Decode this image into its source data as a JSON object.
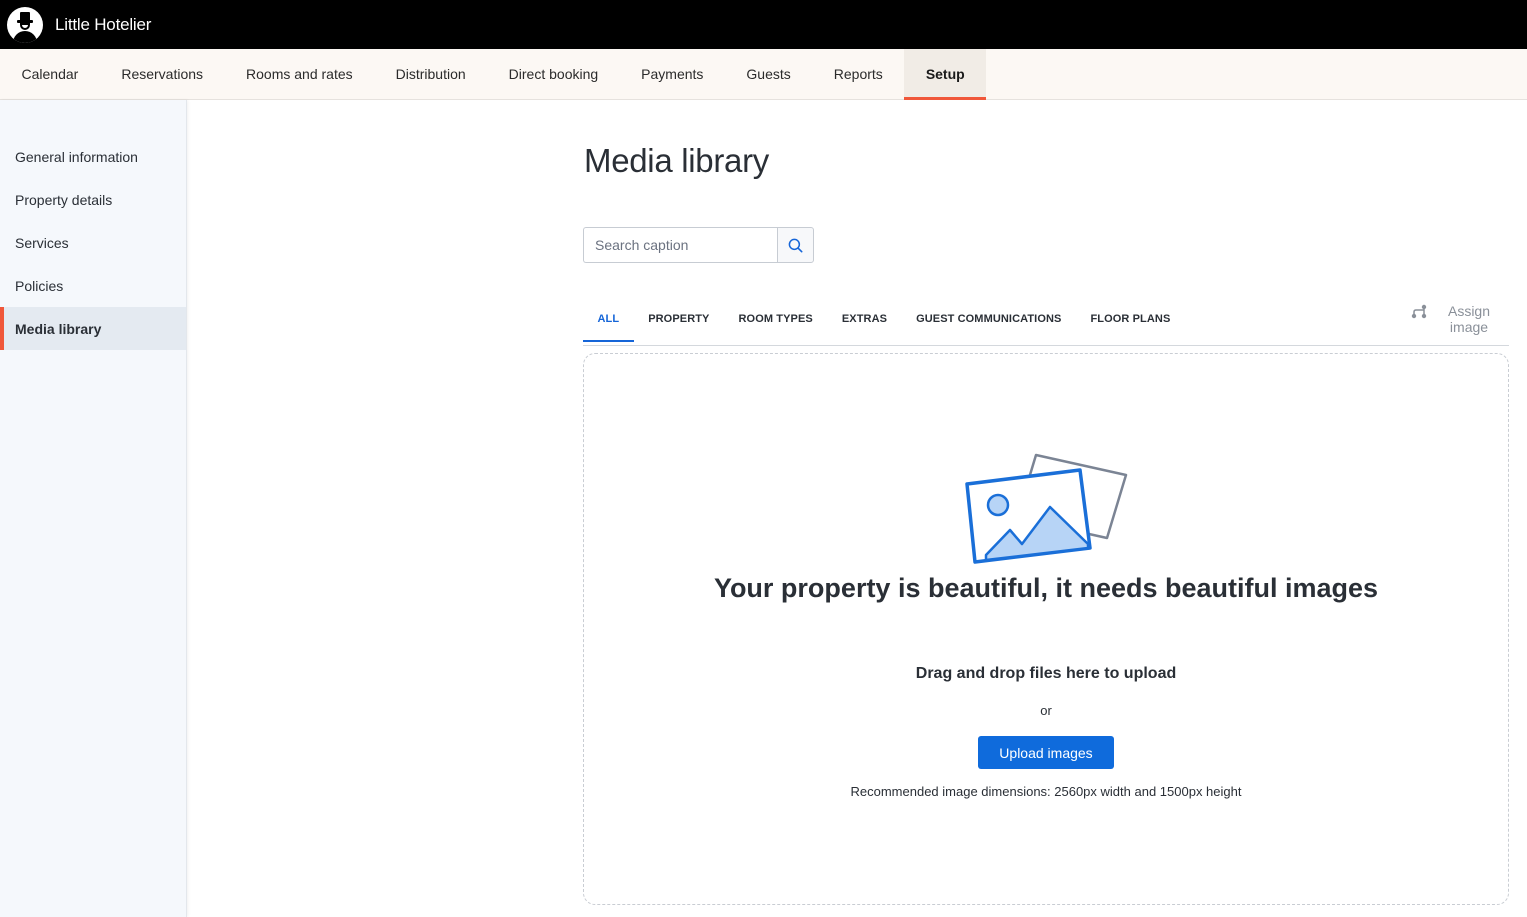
{
  "app": {
    "brand": "Little Hotelier"
  },
  "nav": {
    "tabs": [
      {
        "label": "Calendar"
      },
      {
        "label": "Reservations"
      },
      {
        "label": "Rooms and rates"
      },
      {
        "label": "Distribution"
      },
      {
        "label": "Direct booking"
      },
      {
        "label": "Payments"
      },
      {
        "label": "Guests"
      },
      {
        "label": "Reports"
      },
      {
        "label": "Setup",
        "active": true
      }
    ]
  },
  "sidebar": {
    "items": [
      {
        "label": "General information"
      },
      {
        "label": "Property details"
      },
      {
        "label": "Services"
      },
      {
        "label": "Policies"
      },
      {
        "label": "Media library",
        "active": true
      }
    ]
  },
  "main": {
    "title": "Media library",
    "search": {
      "placeholder": "Search caption",
      "value": "",
      "icon": "search-icon"
    },
    "tabs": [
      {
        "label": "ALL",
        "active": true
      },
      {
        "label": "PROPERTY"
      },
      {
        "label": "ROOM TYPES"
      },
      {
        "label": "EXTRAS"
      },
      {
        "label": "GUEST COMMUNICATIONS"
      },
      {
        "label": "FLOOR PLANS"
      }
    ],
    "assign_image": {
      "label": "Assign image",
      "icon": "assign-image-icon"
    },
    "dropzone": {
      "illustration": "photos-illustration",
      "headline": "Your property is beautiful, it needs beautiful images",
      "drag_text": "Drag and drop files here to upload",
      "or_text": "or",
      "upload_label": "Upload images",
      "recommendation": "Recommended image dimensions: 2560px width and 1500px height"
    }
  },
  "colors": {
    "accent": "#f0573a",
    "primary": "#0f6bdc",
    "active_tab": "#1565d8",
    "topbar": "#000000"
  }
}
